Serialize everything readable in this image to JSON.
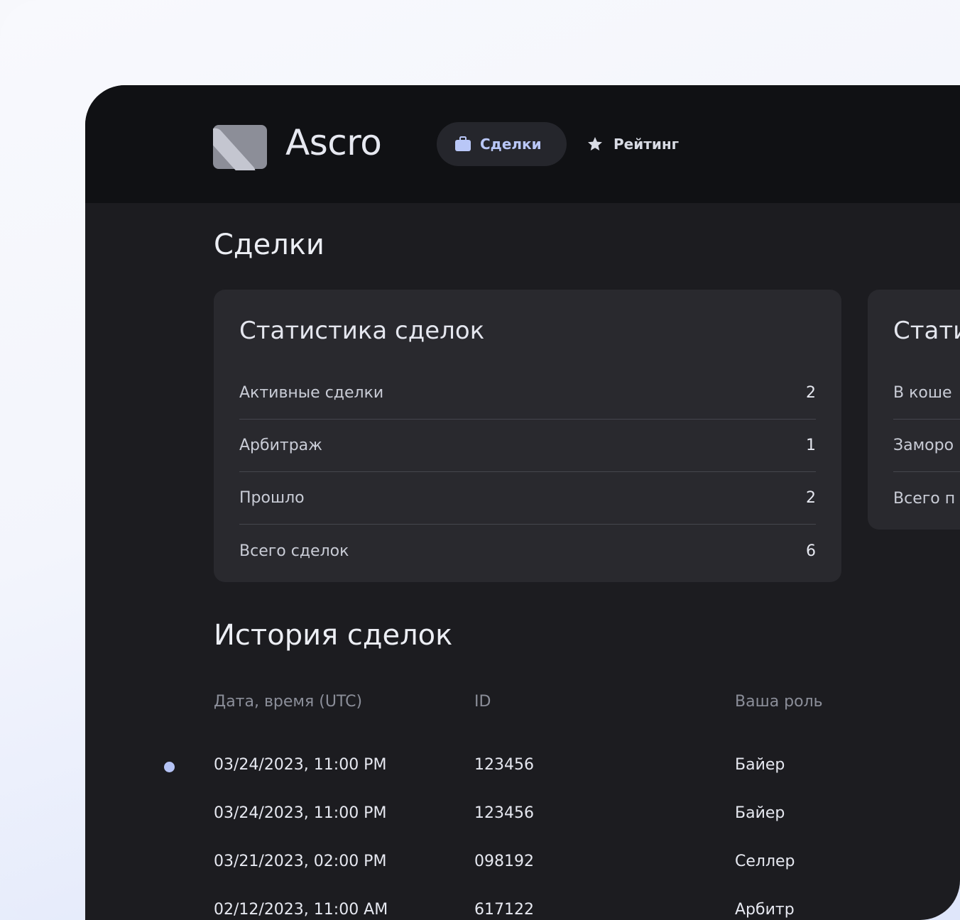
{
  "brand": {
    "name": "Ascro"
  },
  "nav": {
    "items": [
      {
        "label": "Сделки",
        "icon": "briefcase-icon",
        "active": true
      },
      {
        "label": "Рейтинг",
        "icon": "star-icon",
        "active": false
      }
    ]
  },
  "page": {
    "title": "Сделки"
  },
  "stats_card": {
    "title": "Статистика сделок",
    "rows": [
      {
        "label": "Активные сделки",
        "value": "2"
      },
      {
        "label": "Арбитраж",
        "value": "1"
      },
      {
        "label": "Прошло",
        "value": "2"
      },
      {
        "label": "Всего сделок",
        "value": "6"
      }
    ]
  },
  "stats_card_2": {
    "title": "Стати",
    "rows": [
      {
        "label": "В коше"
      },
      {
        "label": "Заморо"
      },
      {
        "label": "Всего п"
      }
    ]
  },
  "history": {
    "title": "История сделок",
    "columns": [
      "Дата, время (UTC)",
      "ID",
      "Ваша роль"
    ],
    "rows": [
      {
        "date": "03/24/2023, 11:00 PM",
        "id": "123456",
        "role": "Байер",
        "unread": true
      },
      {
        "date": "03/24/2023, 11:00 PM",
        "id": "123456",
        "role": "Байер",
        "unread": false
      },
      {
        "date": "03/21/2023, 02:00 PM",
        "id": "098192",
        "role": "Селлер",
        "unread": false
      },
      {
        "date": "02/12/2023, 11:00 AM",
        "id": "617122",
        "role": "Арбитр",
        "unread": false
      }
    ]
  },
  "colors": {
    "accent": "#b5c3f5",
    "background": "#1c1c20",
    "topbar": "#101114",
    "card": "#29292e"
  }
}
